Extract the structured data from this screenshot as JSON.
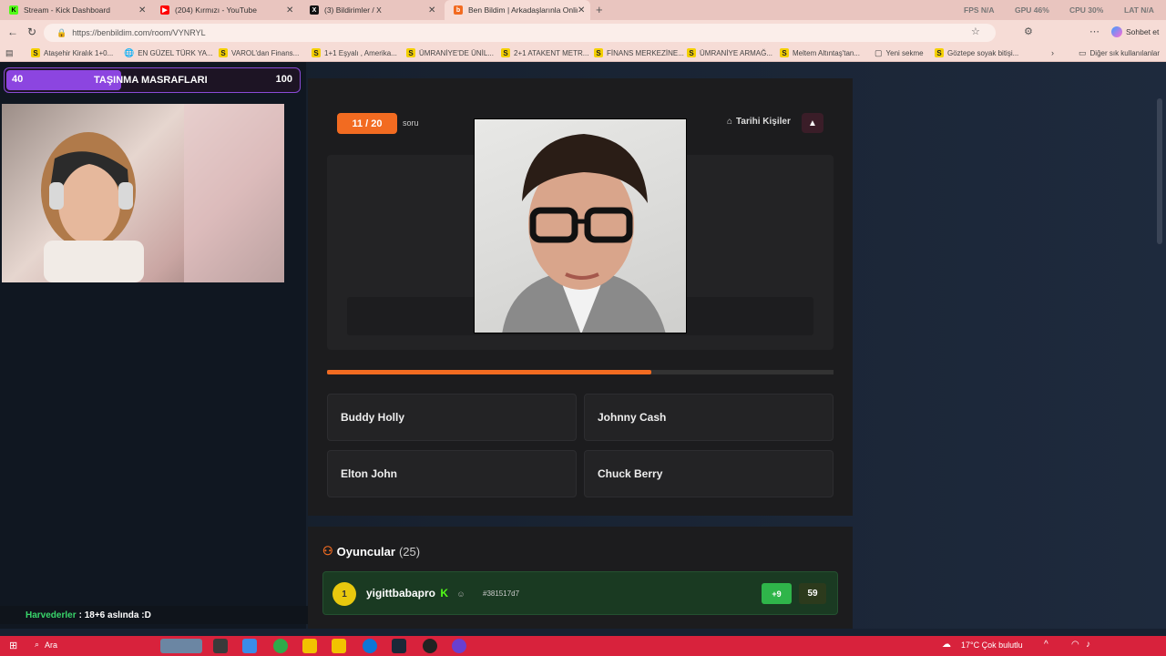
{
  "browser": {
    "tabs": [
      {
        "label": "Stream - Kick Dashboard",
        "icon": "kick-icon",
        "color": "#53fc18",
        "active": false
      },
      {
        "label": "(204) Kırmızı - YouTube",
        "icon": "youtube-icon",
        "color": "#ff0000",
        "active": false
      },
      {
        "label": "(3) Bildirimler / X",
        "icon": "x-icon",
        "color": "#000000",
        "active": false
      },
      {
        "label": "Ben Bildim | Arkadaşlarınla Online",
        "icon": "benbildim-icon",
        "color": "#f26b21",
        "active": true
      }
    ],
    "perf": {
      "fps": "FPS N/A",
      "gpu": "GPU 46%",
      "cpu": "CPU 30%",
      "lat": "LAT N/A"
    },
    "url": "https://benbildim.com/room/VYNRYL",
    "chat_button": "Sohbet et",
    "bookmarks": [
      {
        "label": "Ataşehir Kiralık 1+0...",
        "icon": "s-icon"
      },
      {
        "label": "EN GÜZEL TÜRK YA...",
        "icon": "globe-icon"
      },
      {
        "label": "VAROL'dan Finans...",
        "icon": "s-icon"
      },
      {
        "label": "1+1 Eşyalı , Amerika...",
        "icon": "s-icon"
      },
      {
        "label": "ÜMRANİYE'DE ÜNİL...",
        "icon": "s-icon"
      },
      {
        "label": "2+1 ATAKENT METR...",
        "icon": "s-icon"
      },
      {
        "label": "FİNANS MERKEZİNE...",
        "icon": "s-icon"
      },
      {
        "label": "ÜMRANİYE ARMAĞ...",
        "icon": "s-icon"
      },
      {
        "label": "Meltem Altıntaş'tan...",
        "icon": "s-icon"
      },
      {
        "label": "Yeni sekme",
        "icon": "page-icon"
      },
      {
        "label": "Göztepe soyak bitişi...",
        "icon": "s-icon"
      }
    ],
    "other_bookmarks": "Diğer sık kullanılanlar"
  },
  "stream": {
    "banner": {
      "left": "40",
      "title": "TAŞINMA MASRAFLARI",
      "right": "100",
      "progress_fraction": 0.4,
      "color": "#8c45e0"
    },
    "chat": {
      "user": "Harvederler",
      "message": ": 18+6 aslında :D"
    }
  },
  "quiz": {
    "counter": "11 / 20",
    "counter_word": "soru",
    "category": "Tarihi Kişiler",
    "progress_fraction": 0.64,
    "accent": "#f26b21",
    "answers": [
      "Buddy Holly",
      "Johnny Cash",
      "Elton John",
      "Chuck Berry"
    ]
  },
  "players": {
    "title": "Oyuncular",
    "count": "(25)",
    "rows": [
      {
        "rank": "1",
        "name": "yigittbabapro",
        "id": "#381517d7",
        "delta": "+9",
        "score": "59"
      }
    ]
  },
  "taskbar": {
    "search": "Ara",
    "weather": "17°C  Çok bulutlu"
  }
}
